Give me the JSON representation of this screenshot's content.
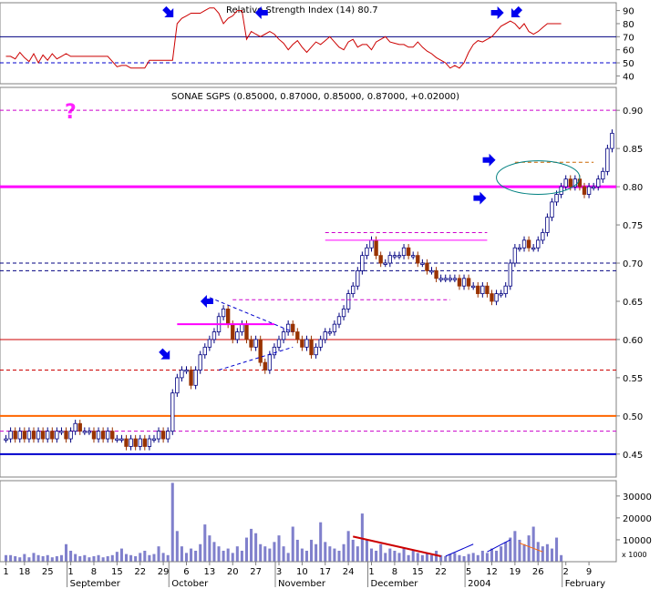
{
  "chart_data": [
    {
      "type": "line",
      "panel": "rsi",
      "title": "Relative Strength Index (14) 80.7",
      "y_ticks": [
        "90",
        "80",
        "70",
        "60",
        "50",
        "40"
      ],
      "ylim": [
        34,
        96
      ],
      "reference_lines": [
        {
          "value": 70,
          "style": "solid",
          "color": "#000080"
        },
        {
          "value": 50,
          "style": "dashed",
          "color": "#0000cc"
        }
      ],
      "values": [
        55,
        55,
        53,
        58,
        54,
        51,
        57,
        50,
        56,
        52,
        57,
        53,
        55,
        57,
        55,
        55,
        55,
        55,
        55,
        55,
        55,
        55,
        55,
        51,
        47,
        48,
        48,
        46,
        46,
        46,
        46,
        52,
        52,
        52,
        52,
        52,
        52,
        80,
        84,
        86,
        88,
        88,
        88,
        90,
        92,
        92,
        88,
        80,
        84,
        86,
        90,
        90,
        68,
        74,
        72,
        70,
        72,
        74,
        72,
        68,
        65,
        60,
        64,
        67,
        62,
        58,
        62,
        66,
        64,
        67,
        70,
        66,
        62,
        60,
        66,
        68,
        62,
        64,
        64,
        60,
        66,
        68,
        70,
        66,
        65,
        64,
        64,
        62,
        62,
        66,
        62,
        59,
        57,
        54,
        52,
        50,
        46,
        48,
        46,
        50,
        58,
        64,
        67,
        66,
        68,
        70,
        74,
        78,
        80,
        82,
        80,
        76,
        80,
        74,
        72,
        74,
        77,
        80,
        80,
        80,
        80
      ],
      "color": "#cc0000",
      "annotations": [
        {
          "shape": "arrow",
          "dir": "down-right",
          "at_index": 36
        },
        {
          "shape": "arrow",
          "dir": "left",
          "at_index": 56
        },
        {
          "shape": "arrow",
          "dir": "right",
          "at_index": 107
        },
        {
          "shape": "arrow",
          "dir": "down-left",
          "at_index": 111
        }
      ]
    },
    {
      "type": "candlestick",
      "panel": "price",
      "title": "SONAE SGPS (0.85000, 0.87000, 0.85000, 0.87000, +0.02000)",
      "y_ticks": [
        "0.90",
        "0.85",
        "0.80",
        "0.75",
        "0.70",
        "0.65",
        "0.60",
        "0.55",
        "0.50",
        "0.45"
      ],
      "ylim": [
        0.42,
        0.93
      ],
      "annotation_text": "?",
      "closes": [
        0.47,
        0.48,
        0.47,
        0.48,
        0.47,
        0.48,
        0.47,
        0.48,
        0.47,
        0.48,
        0.47,
        0.48,
        0.48,
        0.47,
        0.48,
        0.49,
        0.48,
        0.48,
        0.48,
        0.47,
        0.48,
        0.47,
        0.48,
        0.47,
        0.47,
        0.47,
        0.46,
        0.47,
        0.46,
        0.47,
        0.46,
        0.47,
        0.47,
        0.48,
        0.47,
        0.48,
        0.53,
        0.55,
        0.56,
        0.56,
        0.54,
        0.56,
        0.58,
        0.59,
        0.6,
        0.61,
        0.63,
        0.64,
        0.62,
        0.6,
        0.61,
        0.62,
        0.6,
        0.59,
        0.6,
        0.57,
        0.56,
        0.58,
        0.59,
        0.6,
        0.61,
        0.62,
        0.61,
        0.6,
        0.59,
        0.6,
        0.58,
        0.59,
        0.6,
        0.61,
        0.61,
        0.62,
        0.63,
        0.64,
        0.66,
        0.67,
        0.69,
        0.71,
        0.72,
        0.73,
        0.71,
        0.7,
        0.7,
        0.71,
        0.71,
        0.71,
        0.72,
        0.71,
        0.71,
        0.7,
        0.7,
        0.69,
        0.69,
        0.68,
        0.68,
        0.68,
        0.68,
        0.68,
        0.67,
        0.68,
        0.67,
        0.67,
        0.66,
        0.67,
        0.66,
        0.65,
        0.66,
        0.66,
        0.67,
        0.7,
        0.72,
        0.72,
        0.73,
        0.72,
        0.72,
        0.73,
        0.74,
        0.76,
        0.78,
        0.79,
        0.8,
        0.81,
        0.8,
        0.81,
        0.8,
        0.79,
        0.8,
        0.8,
        0.81,
        0.82,
        0.85,
        0.87
      ],
      "reference_lines": [
        {
          "value": 0.9,
          "style": "dashed",
          "color": "#cc00cc"
        },
        {
          "value": 0.8,
          "style": "solid",
          "color": "#ff00ff",
          "width": 3
        },
        {
          "value": 0.7,
          "style": "dashed",
          "color": "#000080"
        },
        {
          "value": 0.69,
          "style": "dashed",
          "color": "#000080"
        },
        {
          "value": 0.6,
          "style": "solid",
          "color": "#cc0000"
        },
        {
          "value": 0.56,
          "style": "dashed",
          "color": "#cc0000"
        },
        {
          "value": 0.5,
          "style": "solid",
          "color": "#ff6600",
          "width": 2
        },
        {
          "value": 0.48,
          "style": "dashed",
          "color": "#cc00cc"
        },
        {
          "value": 0.45,
          "style": "solid",
          "color": "#0000cc",
          "width": 2
        }
      ],
      "segments": [
        {
          "x0": 37,
          "x1": 58,
          "y0": 0.62,
          "y1": 0.62,
          "color": "#ff00ff",
          "width": 2
        },
        {
          "x0": 44,
          "x1": 62,
          "y0": 0.655,
          "y1": 0.61,
          "color": "#0000cc",
          "style": "dashed"
        },
        {
          "x0": 46,
          "x1": 62,
          "y0": 0.56,
          "y1": 0.59,
          "color": "#0000cc",
          "style": "dashed"
        },
        {
          "x0": 69,
          "x1": 104,
          "y0": 0.73,
          "y1": 0.73,
          "color": "#ff00ff"
        },
        {
          "x0": 69,
          "x1": 104,
          "y0": 0.74,
          "y1": 0.74,
          "color": "#cc00cc",
          "style": "dashed"
        },
        {
          "x0": 49,
          "x1": 96,
          "y0": 0.652,
          "y1": 0.652,
          "color": "#cc00cc",
          "style": "dashed"
        },
        {
          "x0": 110,
          "x1": 127,
          "y0": 0.832,
          "y1": 0.832,
          "color": "#cc6600",
          "style": "dashed"
        }
      ],
      "ellipse": {
        "x": 115,
        "y": 0.812,
        "rx": 9,
        "ry": 0.022,
        "color": "#008080"
      },
      "annotations": [
        {
          "shape": "arrow",
          "dir": "down-right",
          "at_index": 36,
          "at_value": 0.58
        },
        {
          "shape": "arrow",
          "dir": "left",
          "at_index": 45,
          "at_value": 0.65
        },
        {
          "shape": "arrow",
          "dir": "right",
          "at_index": 106,
          "at_value": 0.835
        },
        {
          "shape": "arrow",
          "dir": "right",
          "at_index": 104,
          "at_value": 0.785
        }
      ]
    },
    {
      "type": "bar",
      "panel": "volume",
      "y_ticks": [
        "30000",
        "20000",
        "10000"
      ],
      "unit_label": "x 1000",
      "ylim": [
        0,
        37000
      ],
      "values": [
        3000,
        3000,
        2500,
        2000,
        3500,
        2000,
        4000,
        3000,
        2500,
        3000,
        2000,
        2500,
        3000,
        8000,
        5000,
        3500,
        2500,
        3000,
        2000,
        2500,
        3000,
        2000,
        2500,
        3000,
        4500,
        6000,
        3500,
        3000,
        2500,
        4000,
        5000,
        3000,
        3500,
        7000,
        4000,
        3000,
        36000,
        14000,
        7000,
        4000,
        6000,
        5000,
        8000,
        17000,
        12000,
        9000,
        7000,
        5000,
        6000,
        4000,
        7000,
        5000,
        11000,
        15000,
        13000,
        8000,
        7000,
        6000,
        9000,
        12000,
        7000,
        4000,
        16000,
        10000,
        6000,
        5000,
        10000,
        8000,
        18000,
        9000,
        7000,
        6000,
        5000,
        8000,
        14000,
        10000,
        7000,
        22000,
        10000,
        6000,
        5000,
        8000,
        4000,
        6000,
        5000,
        4000,
        6000,
        3000,
        5000,
        4000,
        3000,
        4000,
        3000,
        5000,
        3000,
        2500,
        3500,
        4000,
        3000,
        2500,
        3500,
        4000,
        3000,
        5000,
        4000,
        6000,
        5000,
        7000,
        9000,
        11000,
        14000,
        10000,
        8000,
        12000,
        16000,
        9000,
        7000,
        8000,
        6000,
        11000,
        3000
      ],
      "color": "#8080cc",
      "segments": [
        {
          "x0": 75,
          "x1": 94,
          "y0": 11500,
          "y1": 2500,
          "color": "#cc0000",
          "width": 2
        },
        {
          "x0": 95,
          "x1": 101,
          "y0": 2500,
          "y1": 8000,
          "color": "#0000cc"
        },
        {
          "x0": 104,
          "x1": 109,
          "y0": 4500,
          "y1": 10000,
          "color": "#0000cc"
        },
        {
          "x0": 111,
          "x1": 116,
          "y0": 8500,
          "y1": 4500,
          "color": "#ff6600"
        }
      ]
    }
  ],
  "x_axis": {
    "day_labels": [
      {
        "text": "1",
        "index": 0
      },
      {
        "text": "18",
        "index": 4
      },
      {
        "text": "25",
        "index": 9
      },
      {
        "text": "1",
        "index": 14
      },
      {
        "text": "8",
        "index": 19
      },
      {
        "text": "15",
        "index": 24
      },
      {
        "text": "22",
        "index": 29
      },
      {
        "text": "29",
        "index": 34
      },
      {
        "text": "6",
        "index": 39
      },
      {
        "text": "13",
        "index": 44
      },
      {
        "text": "20",
        "index": 49
      },
      {
        "text": "27",
        "index": 54
      },
      {
        "text": "3",
        "index": 59
      },
      {
        "text": "10",
        "index": 64
      },
      {
        "text": "17",
        "index": 69
      },
      {
        "text": "24",
        "index": 74
      },
      {
        "text": "1",
        "index": 79
      },
      {
        "text": "8",
        "index": 84
      },
      {
        "text": "15",
        "index": 89
      },
      {
        "text": "22",
        "index": 94
      },
      {
        "text": "5",
        "index": 100
      },
      {
        "text": "12",
        "index": 105
      },
      {
        "text": "19",
        "index": 110
      },
      {
        "text": "26",
        "index": 115
      },
      {
        "text": "2",
        "index": 121
      },
      {
        "text": "9",
        "index": 126
      }
    ],
    "month_labels": [
      {
        "text": "September",
        "index": 14
      },
      {
        "text": "October",
        "index": 36
      },
      {
        "text": "November",
        "index": 59
      },
      {
        "text": "December",
        "index": 79
      },
      {
        "text": "2004",
        "index": 100
      },
      {
        "text": "February",
        "index": 121
      }
    ]
  }
}
